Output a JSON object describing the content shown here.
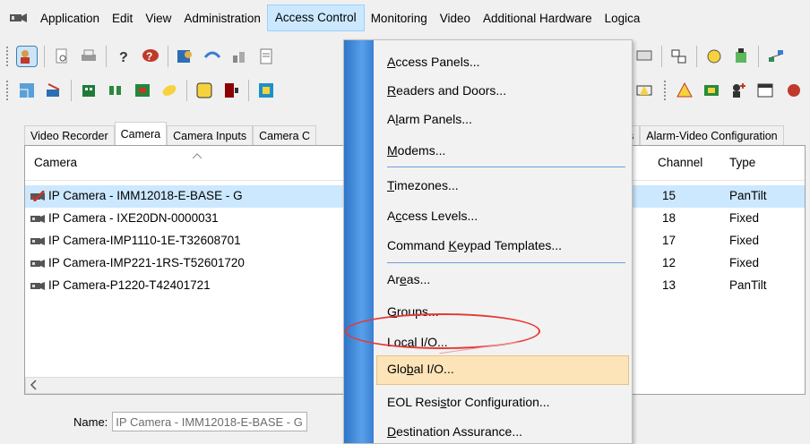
{
  "menubar": {
    "items": [
      "Application",
      "Edit",
      "View",
      "Administration",
      "Access Control",
      "Monitoring",
      "Video",
      "Additional Hardware",
      "Logica"
    ],
    "active_item": "Access Control"
  },
  "tabs": [
    "Video Recorder",
    "Camera",
    "Camera Inputs",
    "Camera C",
    "s",
    "Alarm-Video Configuration"
  ],
  "list": {
    "columns": [
      "Camera",
      "Channel",
      "Type"
    ],
    "rows": [
      {
        "name": "IP Camera - IMM12018-E-BASE - G",
        "channel": "15",
        "type": "PanTilt"
      },
      {
        "name": "IP Camera - IXE20DN-0000031",
        "channel": "18",
        "type": "Fixed"
      },
      {
        "name": "IP Camera-IMP1110-1E-T32608701",
        "channel": "17",
        "type": "Fixed"
      },
      {
        "name": "IP Camera-IMP221-1RS-T52601720",
        "channel": "12",
        "type": "Fixed"
      },
      {
        "name": "IP Camera-P1220-T42401721",
        "channel": "13",
        "type": "PanTilt"
      }
    ]
  },
  "name_field": {
    "label": "Name:",
    "value": "IP Camera - IMM12018-E-BASE - G"
  },
  "dropdown": {
    "items": [
      {
        "pre": "",
        "u": "A",
        "post": "ccess Panels..."
      },
      {
        "pre": "",
        "u": "R",
        "post": "eaders and Doors..."
      },
      {
        "pre": "A",
        "u": "l",
        "post": "arm Panels..."
      },
      {
        "pre": "",
        "u": "M",
        "post": "odems..."
      },
      {
        "pre": "",
        "u": "T",
        "post": "imezones..."
      },
      {
        "pre": "A",
        "u": "c",
        "post": "cess Levels..."
      },
      {
        "pre": "Command ",
        "u": "K",
        "post": "eypad Templates..."
      },
      {
        "pre": "Ar",
        "u": "e",
        "post": "as..."
      },
      {
        "pre": "",
        "u": "G",
        "post": "roups..."
      },
      {
        "pre": "Local I/",
        "u": "O",
        "post": "..."
      },
      {
        "pre": "Glo",
        "u": "b",
        "post": "al I/O..."
      },
      {
        "pre": "EOL Resi",
        "u": "s",
        "post": "tor Configuration..."
      },
      {
        "pre": "",
        "u": "D",
        "post": "estination Assurance..."
      }
    ]
  },
  "colors": {
    "selection": "#cce8ff",
    "highlight": "#fde4b8",
    "annotation": "#e53935",
    "menu_stripe": "#3b80d4"
  }
}
